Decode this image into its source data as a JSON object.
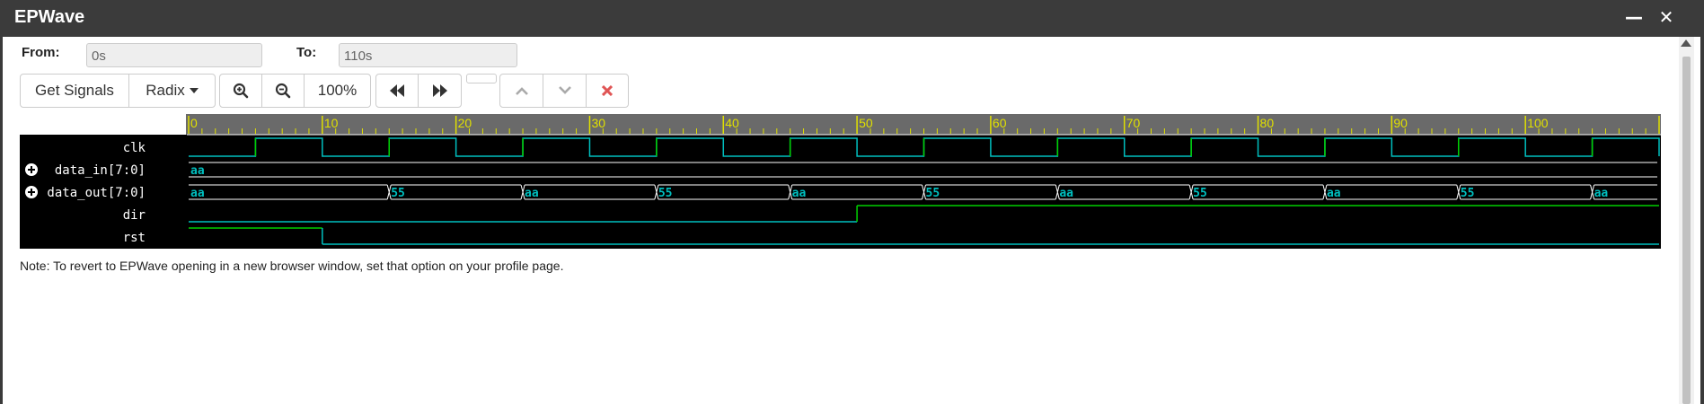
{
  "window": {
    "title": "EPWave"
  },
  "range": {
    "from_label": "From:",
    "from_value": "0s",
    "to_label": "To:",
    "to_value": "110s"
  },
  "toolbar": {
    "get_signals_label": "Get Signals",
    "radix_label": "Radix",
    "zoom_level": "100%",
    "icons": [
      "zoom-in-icon",
      "zoom-out-icon",
      "rewind-icon",
      "fast-forward-icon",
      "chevron-up-icon",
      "chevron-down-icon",
      "delete-icon"
    ]
  },
  "colors": {
    "green": "#00d000",
    "cyan": "#00bfbf",
    "ruler_tick": "#e0e000",
    "ruler_bg": "#6a6a6a",
    "delete_red": "#e05555"
  },
  "waveform": {
    "time_max": 110,
    "ticks": [
      0,
      10,
      20,
      30,
      40,
      50,
      60,
      70,
      80,
      90,
      100
    ],
    "signals": [
      {
        "name": "clk",
        "expandable": false
      },
      {
        "name": "data_in[7:0]",
        "expandable": true
      },
      {
        "name": "data_out[7:0]",
        "expandable": true
      },
      {
        "name": "dir",
        "expandable": false
      },
      {
        "name": "rst",
        "expandable": false
      }
    ],
    "clk_period": 10,
    "data_in_value": "aa",
    "data_out": [
      {
        "t": 0,
        "v": "aa"
      },
      {
        "t": 15,
        "v": "55"
      },
      {
        "t": 25,
        "v": "aa"
      },
      {
        "t": 35,
        "v": "55"
      },
      {
        "t": 45,
        "v": "aa"
      },
      {
        "t": 55,
        "v": "55"
      },
      {
        "t": 65,
        "v": "aa"
      },
      {
        "t": 75,
        "v": "55"
      },
      {
        "t": 85,
        "v": "aa"
      },
      {
        "t": 95,
        "v": "55"
      },
      {
        "t": 105,
        "v": "aa"
      }
    ],
    "dir_rise": 50,
    "rst_fall": 10
  },
  "note": "Note: To revert to EPWave opening in a new browser window, set that option on your profile page."
}
